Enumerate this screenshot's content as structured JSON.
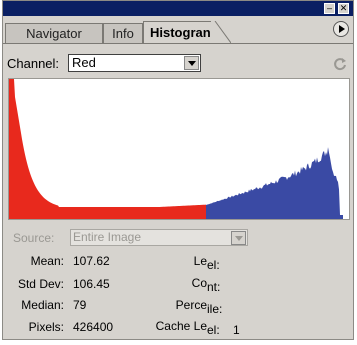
{
  "tabs": [
    {
      "label": "Navigator",
      "active": false
    },
    {
      "label": "Info",
      "active": false
    },
    {
      "label": "Histogran",
      "active": true
    }
  ],
  "channel": {
    "label": "Channel:",
    "value": "Red"
  },
  "source": {
    "label": "Source:",
    "value": "Entire Image",
    "disabled": true
  },
  "stats_left": [
    {
      "label": "Mean:",
      "value": "107.62"
    },
    {
      "label": "Std Dev:",
      "value": "106.45"
    },
    {
      "label": "Median:",
      "value": "79"
    },
    {
      "label": "Pixels:",
      "value": "426400"
    }
  ],
  "stats_right": [
    {
      "label": "Le",
      "suffix": "el:",
      "value": ""
    },
    {
      "label": "Co",
      "suffix": "nt:",
      "value": ""
    },
    {
      "label": "Perce",
      "suffix": "ile:",
      "value": ""
    },
    {
      "label": "Cache Le",
      "suffix": "el:",
      "value": "1"
    }
  ],
  "histogram": {
    "red_color": "#e8291d",
    "blue_color": "#3a4aa4"
  },
  "colors": {
    "titlebar": "#0a1f63",
    "panel_bg": "#d6d3ce"
  }
}
